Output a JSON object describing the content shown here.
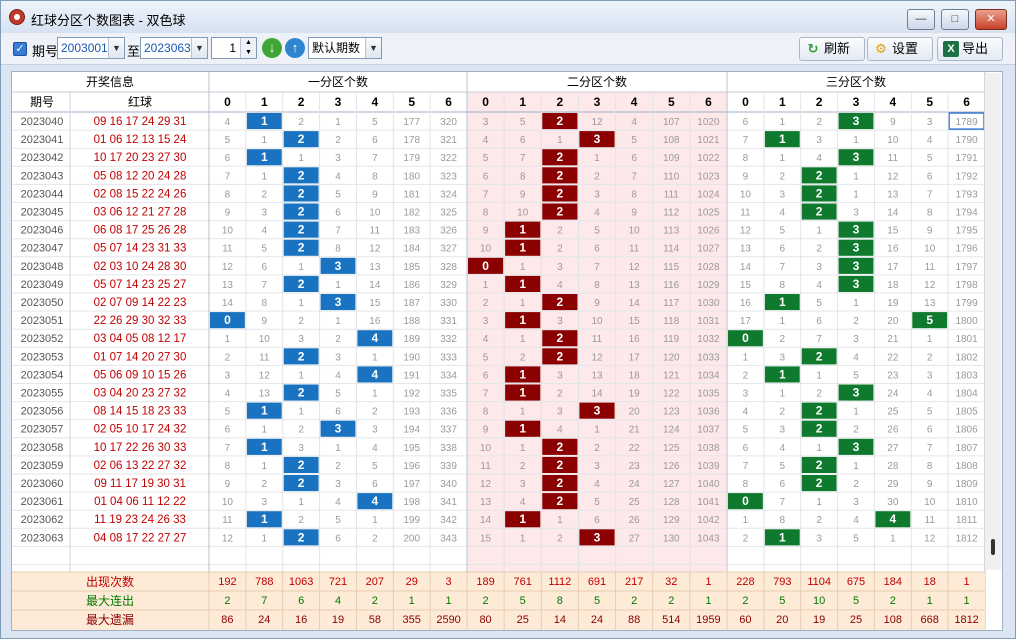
{
  "window": {
    "title": "红球分区个数图表 - 双色球",
    "min": "—",
    "max": "□",
    "close": "✕"
  },
  "toolbar": {
    "period_label": "期号",
    "from": "2003001",
    "to_label": "至",
    "to": "2023063",
    "count": "1",
    "mode": "默认期数",
    "refresh": "刷新",
    "settings": "设置",
    "export": "导出"
  },
  "colors": {
    "zone1": "#1a73c0",
    "zone2": "#8b0000",
    "zone3": "#0f7a2e",
    "zone2_bg": "#fde8ea",
    "stat_bg": "#fdebd8"
  },
  "headers": {
    "info": "开奖信息",
    "period": "期号",
    "red": "红球",
    "zones": [
      "一分区个数",
      "二分区个数",
      "三分区个数"
    ],
    "cols": [
      "0",
      "1",
      "2",
      "3",
      "4",
      "5",
      "6"
    ]
  },
  "rows": [
    {
      "p": "2023040",
      "b": "09 16 17 24 29 31",
      "z1": [
        "4",
        "1",
        "2",
        "1",
        "5",
        "177",
        "320"
      ],
      "z2": [
        "3",
        "5",
        "2",
        "12",
        "4",
        "107",
        "1020"
      ],
      "z3": [
        "6",
        "1",
        "2",
        "3",
        "9",
        "3",
        "1789"
      ],
      "h": [
        1,
        2,
        3
      ]
    },
    {
      "p": "2023041",
      "b": "01 06 12 13 15 24",
      "z1": [
        "5",
        "1",
        "2",
        "2",
        "6",
        "178",
        "321"
      ],
      "z2": [
        "4",
        "6",
        "1",
        "3",
        "5",
        "108",
        "1021"
      ],
      "z3": [
        "7",
        "1",
        "3",
        "1",
        "10",
        "4",
        "1790"
      ],
      "h": [
        2,
        3,
        1
      ]
    },
    {
      "p": "2023042",
      "b": "10 17 20 23 27 30",
      "z1": [
        "6",
        "1",
        "1",
        "3",
        "7",
        "179",
        "322"
      ],
      "z2": [
        "5",
        "7",
        "2",
        "1",
        "6",
        "109",
        "1022"
      ],
      "z3": [
        "8",
        "1",
        "4",
        "3",
        "11",
        "5",
        "1791"
      ],
      "h": [
        1,
        2,
        3
      ]
    },
    {
      "p": "2023043",
      "b": "05 08 12 20 24 28",
      "z1": [
        "7",
        "1",
        "2",
        "4",
        "8",
        "180",
        "323"
      ],
      "z2": [
        "6",
        "8",
        "2",
        "2",
        "7",
        "110",
        "1023"
      ],
      "z3": [
        "9",
        "2",
        "2",
        "1",
        "12",
        "6",
        "1792"
      ],
      "h": [
        2,
        2,
        2
      ]
    },
    {
      "p": "2023044",
      "b": "02 08 15 22 24 26",
      "z1": [
        "8",
        "2",
        "2",
        "5",
        "9",
        "181",
        "324"
      ],
      "z2": [
        "7",
        "9",
        "2",
        "3",
        "8",
        "111",
        "1024"
      ],
      "z3": [
        "10",
        "3",
        "2",
        "1",
        "13",
        "7",
        "1793"
      ],
      "h": [
        2,
        2,
        2
      ]
    },
    {
      "p": "2023045",
      "b": "03 06 12 21 27 28",
      "z1": [
        "9",
        "3",
        "2",
        "6",
        "10",
        "182",
        "325"
      ],
      "z2": [
        "8",
        "10",
        "2",
        "4",
        "9",
        "112",
        "1025"
      ],
      "z3": [
        "11",
        "4",
        "2",
        "3",
        "14",
        "8",
        "1794"
      ],
      "h": [
        2,
        2,
        2
      ]
    },
    {
      "p": "2023046",
      "b": "06 08 17 25 26 28",
      "z1": [
        "10",
        "4",
        "2",
        "7",
        "11",
        "183",
        "326"
      ],
      "z2": [
        "9",
        "1",
        "2",
        "5",
        "10",
        "113",
        "1026"
      ],
      "z3": [
        "12",
        "5",
        "1",
        "3",
        "15",
        "9",
        "1795"
      ],
      "h": [
        2,
        1,
        3
      ]
    },
    {
      "p": "2023047",
      "b": "05 07 14 23 31 33",
      "z1": [
        "11",
        "5",
        "2",
        "8",
        "12",
        "184",
        "327"
      ],
      "z2": [
        "10",
        "1",
        "2",
        "6",
        "11",
        "114",
        "1027"
      ],
      "z3": [
        "13",
        "6",
        "2",
        "3",
        "16",
        "10",
        "1796"
      ],
      "h": [
        2,
        1,
        3
      ]
    },
    {
      "p": "2023048",
      "b": "02 03 10 24 28 30",
      "z1": [
        "12",
        "6",
        "1",
        "3",
        "13",
        "185",
        "328"
      ],
      "z2": [
        "0",
        "1",
        "3",
        "7",
        "12",
        "115",
        "1028"
      ],
      "z3": [
        "14",
        "7",
        "3",
        "3",
        "17",
        "11",
        "1797"
      ],
      "h": [
        3,
        0,
        3
      ]
    },
    {
      "p": "2023049",
      "b": "05 07 14 23 25 27",
      "z1": [
        "13",
        "7",
        "2",
        "1",
        "14",
        "186",
        "329"
      ],
      "z2": [
        "1",
        "1",
        "4",
        "8",
        "13",
        "116",
        "1029"
      ],
      "z3": [
        "15",
        "8",
        "4",
        "3",
        "18",
        "12",
        "1798"
      ],
      "h": [
        2,
        1,
        3
      ]
    },
    {
      "p": "2023050",
      "b": "02 07 09 14 22 23",
      "z1": [
        "14",
        "8",
        "1",
        "3",
        "15",
        "187",
        "330"
      ],
      "z2": [
        "2",
        "1",
        "2",
        "9",
        "14",
        "117",
        "1030"
      ],
      "z3": [
        "16",
        "1",
        "5",
        "1",
        "19",
        "13",
        "1799"
      ],
      "h": [
        3,
        2,
        1
      ]
    },
    {
      "p": "2023051",
      "b": "22 26 29 30 32 33",
      "z1": [
        "0",
        "9",
        "2",
        "1",
        "16",
        "188",
        "331"
      ],
      "z2": [
        "3",
        "1",
        "3",
        "10",
        "15",
        "118",
        "1031"
      ],
      "z3": [
        "17",
        "1",
        "6",
        "2",
        "20",
        "5",
        "1800"
      ],
      "h": [
        0,
        1,
        5
      ]
    },
    {
      "p": "2023052",
      "b": "03 04 05 08 12 17",
      "z1": [
        "1",
        "10",
        "3",
        "2",
        "4",
        "189",
        "332"
      ],
      "z2": [
        "4",
        "1",
        "2",
        "11",
        "16",
        "119",
        "1032"
      ],
      "z3": [
        "0",
        "2",
        "7",
        "3",
        "21",
        "1",
        "1801"
      ],
      "h": [
        4,
        2,
        0
      ]
    },
    {
      "p": "2023053",
      "b": "01 07 14 20 27 30",
      "z1": [
        "2",
        "11",
        "2",
        "3",
        "1",
        "190",
        "333"
      ],
      "z2": [
        "5",
        "2",
        "2",
        "12",
        "17",
        "120",
        "1033"
      ],
      "z3": [
        "1",
        "3",
        "2",
        "4",
        "22",
        "2",
        "1802"
      ],
      "h": [
        2,
        2,
        2
      ]
    },
    {
      "p": "2023054",
      "b": "05 06 09 10 15 26",
      "z1": [
        "3",
        "12",
        "1",
        "4",
        "4",
        "191",
        "334"
      ],
      "z2": [
        "6",
        "1",
        "3",
        "13",
        "18",
        "121",
        "1034"
      ],
      "z3": [
        "2",
        "1",
        "1",
        "5",
        "23",
        "3",
        "1803"
      ],
      "h": [
        4,
        1,
        1
      ]
    },
    {
      "p": "2023055",
      "b": "03 04 20 23 27 32",
      "z1": [
        "4",
        "13",
        "2",
        "5",
        "1",
        "192",
        "335"
      ],
      "z2": [
        "7",
        "1",
        "2",
        "14",
        "19",
        "122",
        "1035"
      ],
      "z3": [
        "3",
        "1",
        "2",
        "3",
        "24",
        "4",
        "1804"
      ],
      "h": [
        2,
        1,
        3
      ]
    },
    {
      "p": "2023056",
      "b": "08 14 15 18 23 33",
      "z1": [
        "5",
        "1",
        "1",
        "6",
        "2",
        "193",
        "336"
      ],
      "z2": [
        "8",
        "1",
        "3",
        "3",
        "20",
        "123",
        "1036"
      ],
      "z3": [
        "4",
        "2",
        "2",
        "1",
        "25",
        "5",
        "1805"
      ],
      "h": [
        1,
        3,
        2
      ]
    },
    {
      "p": "2023057",
      "b": "02 05 10 17 24 32",
      "z1": [
        "6",
        "1",
        "2",
        "3",
        "3",
        "194",
        "337"
      ],
      "z2": [
        "9",
        "1",
        "4",
        "1",
        "21",
        "124",
        "1037"
      ],
      "z3": [
        "5",
        "3",
        "2",
        "2",
        "26",
        "6",
        "1806"
      ],
      "h": [
        3,
        1,
        2
      ]
    },
    {
      "p": "2023058",
      "b": "10 17 22 26 30 33",
      "z1": [
        "7",
        "1",
        "3",
        "1",
        "4",
        "195",
        "338"
      ],
      "z2": [
        "10",
        "1",
        "2",
        "2",
        "22",
        "125",
        "1038"
      ],
      "z3": [
        "6",
        "4",
        "1",
        "3",
        "27",
        "7",
        "1807"
      ],
      "h": [
        1,
        2,
        3
      ]
    },
    {
      "p": "2023059",
      "b": "02 06 13 22 27 32",
      "z1": [
        "8",
        "1",
        "2",
        "2",
        "5",
        "196",
        "339"
      ],
      "z2": [
        "11",
        "2",
        "2",
        "3",
        "23",
        "126",
        "1039"
      ],
      "z3": [
        "7",
        "5",
        "2",
        "1",
        "28",
        "8",
        "1808"
      ],
      "h": [
        2,
        2,
        2
      ]
    },
    {
      "p": "2023060",
      "b": "09 11 17 19 30 31",
      "z1": [
        "9",
        "2",
        "2",
        "3",
        "6",
        "197",
        "340"
      ],
      "z2": [
        "12",
        "3",
        "2",
        "4",
        "24",
        "127",
        "1040"
      ],
      "z3": [
        "8",
        "6",
        "2",
        "2",
        "29",
        "9",
        "1809"
      ],
      "h": [
        2,
        2,
        2
      ]
    },
    {
      "p": "2023061",
      "b": "01 04 06 11 12 22",
      "z1": [
        "10",
        "3",
        "1",
        "4",
        "4",
        "198",
        "341"
      ],
      "z2": [
        "13",
        "4",
        "2",
        "5",
        "25",
        "128",
        "1041"
      ],
      "z3": [
        "0",
        "7",
        "1",
        "3",
        "30",
        "10",
        "1810"
      ],
      "h": [
        4,
        2,
        0
      ]
    },
    {
      "p": "2023062",
      "b": "11 19 23 24 26 33",
      "z1": [
        "11",
        "1",
        "2",
        "5",
        "1",
        "199",
        "342"
      ],
      "z2": [
        "14",
        "1",
        "1",
        "6",
        "26",
        "129",
        "1042"
      ],
      "z3": [
        "1",
        "8",
        "2",
        "4",
        "4",
        "11",
        "1811"
      ],
      "h": [
        1,
        1,
        4
      ]
    },
    {
      "p": "2023063",
      "b": "04 08 17 22 27 27",
      "z1": [
        "12",
        "1",
        "2",
        "6",
        "2",
        "200",
        "343"
      ],
      "z2": [
        "15",
        "1",
        "2",
        "3",
        "27",
        "130",
        "1043"
      ],
      "z3": [
        "2",
        "1",
        "3",
        "5",
        "1",
        "12",
        "1812"
      ],
      "h": [
        2,
        3,
        1
      ]
    }
  ],
  "stats": [
    {
      "label": "出现次数",
      "color": "#c00000",
      "z1": [
        "192",
        "788",
        "1063",
        "721",
        "207",
        "29",
        "3"
      ],
      "z2": [
        "189",
        "761",
        "1112",
        "691",
        "217",
        "32",
        "1"
      ],
      "z3": [
        "228",
        "793",
        "1104",
        "675",
        "184",
        "18",
        "1"
      ]
    },
    {
      "label": "最大连出",
      "color": "#007a00",
      "z1": [
        "2",
        "7",
        "6",
        "4",
        "2",
        "1",
        "1"
      ],
      "z2": [
        "2",
        "5",
        "8",
        "5",
        "2",
        "2",
        "1"
      ],
      "z3": [
        "2",
        "5",
        "10",
        "5",
        "2",
        "1",
        "1"
      ]
    },
    {
      "label": "最大遗漏",
      "color": "#8b0000",
      "z1": [
        "86",
        "24",
        "16",
        "19",
        "58",
        "355",
        "2590"
      ],
      "z2": [
        "80",
        "25",
        "14",
        "24",
        "88",
        "514",
        "1959"
      ],
      "z3": [
        "60",
        "20",
        "19",
        "25",
        "108",
        "668",
        "1812"
      ]
    }
  ]
}
